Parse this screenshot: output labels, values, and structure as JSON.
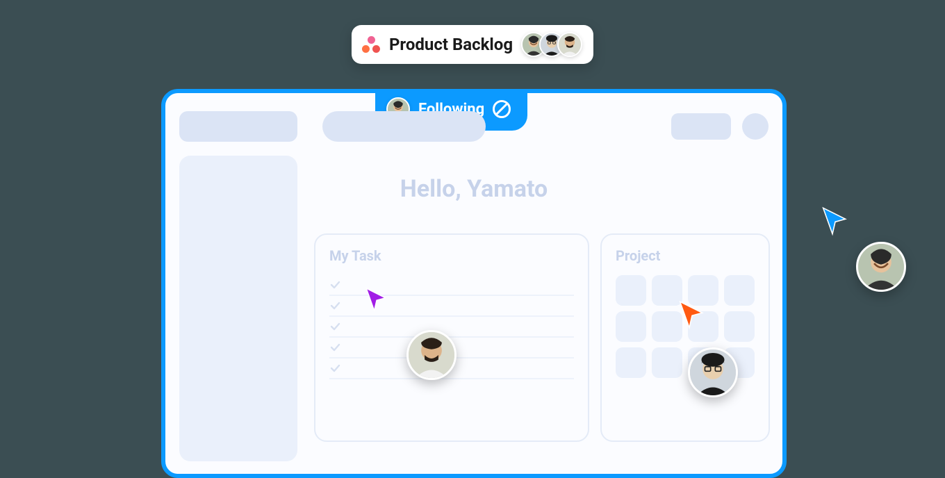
{
  "project": {
    "name": "Product Backlog",
    "members": [
      "user-a",
      "user-b",
      "user-c"
    ]
  },
  "following": {
    "label": "Following",
    "user": "user-a"
  },
  "main": {
    "greeting": "Hello, Yamato",
    "mytask_title": "My Task",
    "project_title": "Project",
    "task_count": 5,
    "tile_count": 12
  },
  "cursors": {
    "purple": "#a11de6",
    "orange": "#ff5a12",
    "blue": "#0c9aff"
  }
}
